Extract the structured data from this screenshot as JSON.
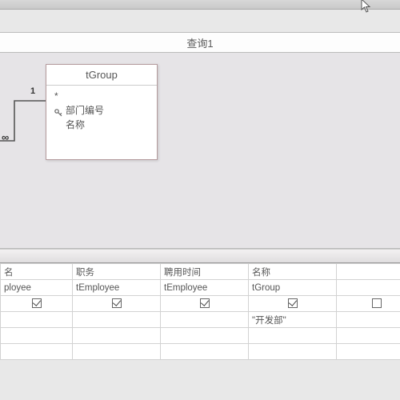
{
  "tab_title": "查询1",
  "table": {
    "name": "tGroup",
    "fields": [
      {
        "label": "*",
        "key": false
      },
      {
        "label": "部门编号",
        "key": true
      },
      {
        "label": "名称",
        "key": false
      }
    ]
  },
  "relation": {
    "near": "1",
    "far": "∞"
  },
  "grid": {
    "rows": {
      "field": [
        "名",
        "职务",
        "聘用时间",
        "名称",
        ""
      ],
      "table": [
        "ployee",
        "tEmployee",
        "tEmployee",
        "tGroup",
        ""
      ],
      "show": [
        true,
        true,
        true,
        true,
        false
      ],
      "criteria": [
        "",
        "",
        "",
        "\"开发部\"",
        ""
      ]
    }
  }
}
